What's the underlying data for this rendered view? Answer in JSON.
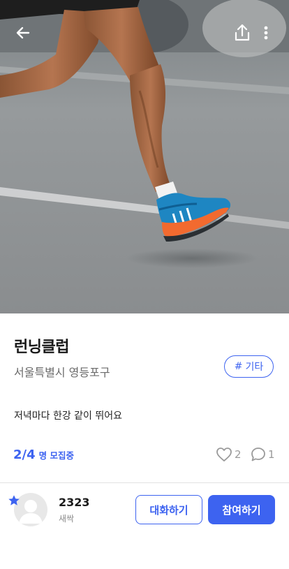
{
  "hero": {
    "photo": "runner-legs-on-road",
    "back_icon": "arrow-left-icon",
    "share_icon": "share-icon",
    "more_icon": "more-vertical-icon"
  },
  "club": {
    "title": "런닝클럽",
    "location": "서울특별시 영등포구",
    "tag": {
      "hash": "#",
      "label": "기타"
    },
    "description": "저녁마다 한강 같이 뛰어요",
    "recruit": {
      "count": "2/4",
      "label": "명 모집중"
    },
    "likes": "2",
    "comments": "1"
  },
  "host": {
    "name": "2323",
    "level": "새싹",
    "badge_icon": "star-icon"
  },
  "actions": {
    "chat_label": "대화하기",
    "join_label": "참여하기"
  },
  "colors": {
    "accent": "#3d63f0",
    "muted": "#9a9a9a"
  }
}
